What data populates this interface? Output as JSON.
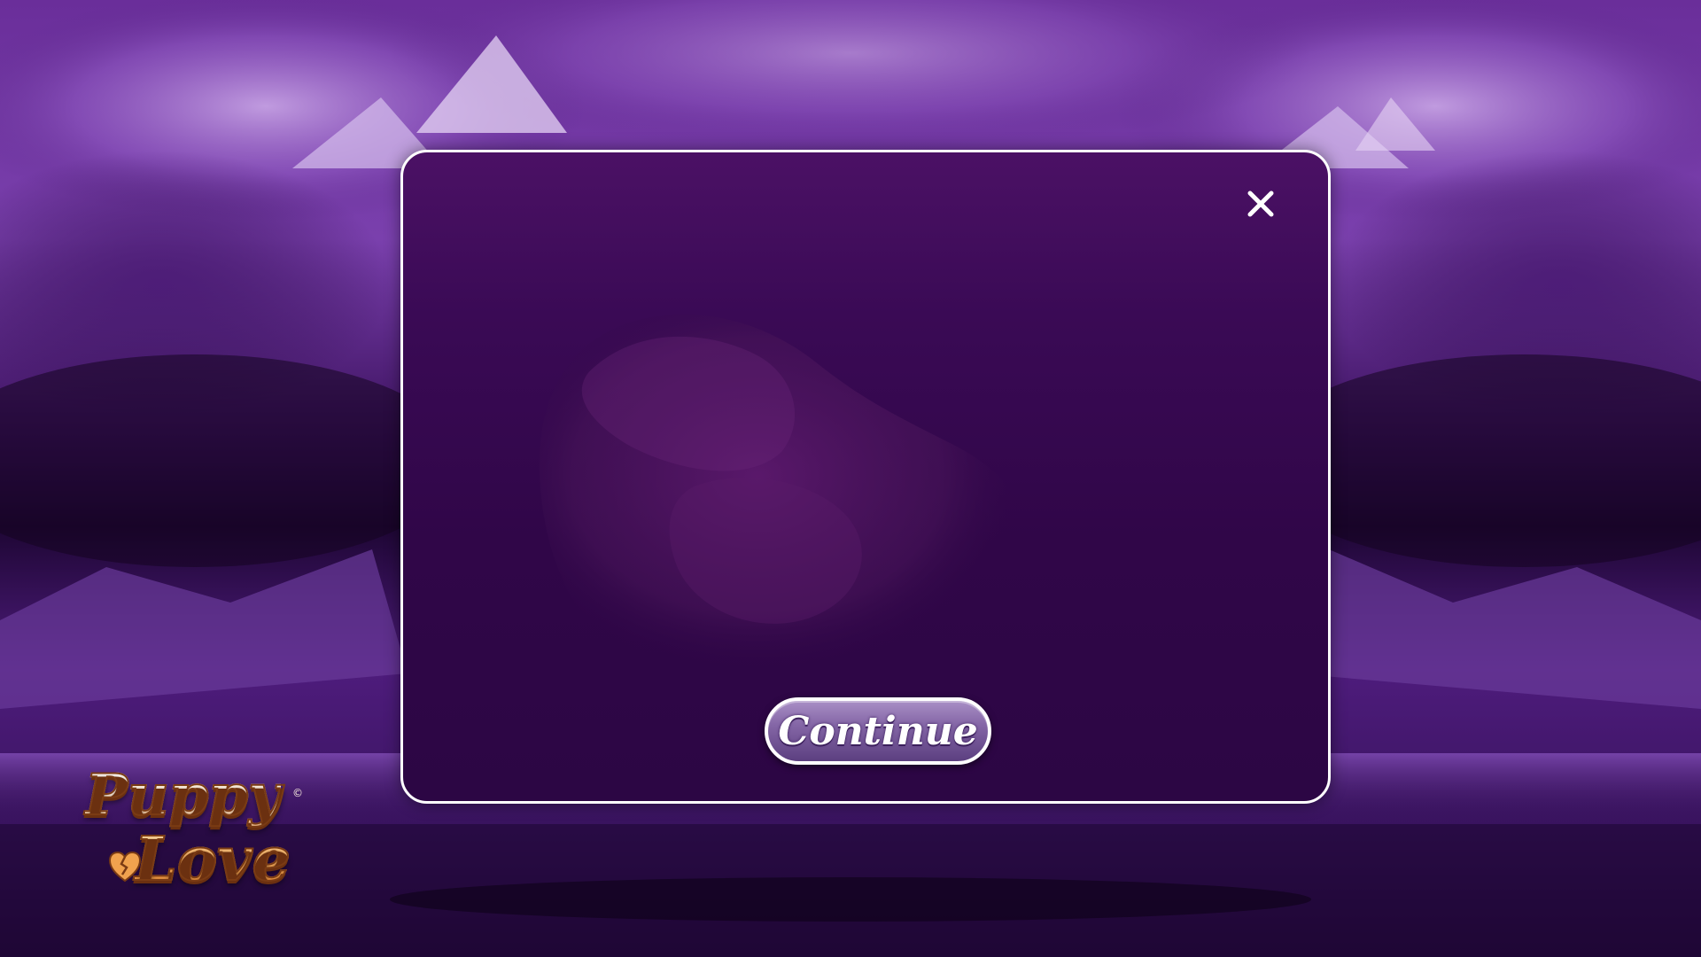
{
  "dialog": {
    "close_icon": "close-icon",
    "continue_label": "Continue"
  },
  "logo": {
    "line1": "Puppy",
    "line2": "Love",
    "copyright": "©",
    "heart_icon": "broken-heart-icon"
  },
  "colors": {
    "background": "#2a0a45",
    "modal_fill": "#3a0a55",
    "modal_border": "#ffffff",
    "button_fill": "#8466a6",
    "logo_gold": "#f6ad5e"
  }
}
